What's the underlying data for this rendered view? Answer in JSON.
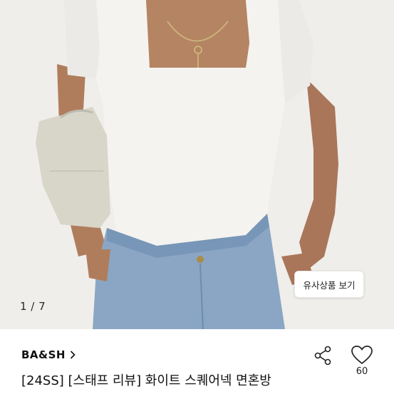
{
  "gallery": {
    "page_counter": "1 / 7",
    "similar_button": "유사상품 보기"
  },
  "product": {
    "brand": "BA&SH",
    "title": "[24SS] [스태프 리뷰] 화이트 스퀘어넥 면혼방",
    "like_count": "60"
  },
  "icons": {
    "brand_chevron": "chevron-right-icon",
    "share": "share-icon",
    "like": "heart-outline-icon"
  },
  "colors": {
    "background": "#ffffff",
    "text": "#111111",
    "button_border": "#e6e6e6"
  }
}
